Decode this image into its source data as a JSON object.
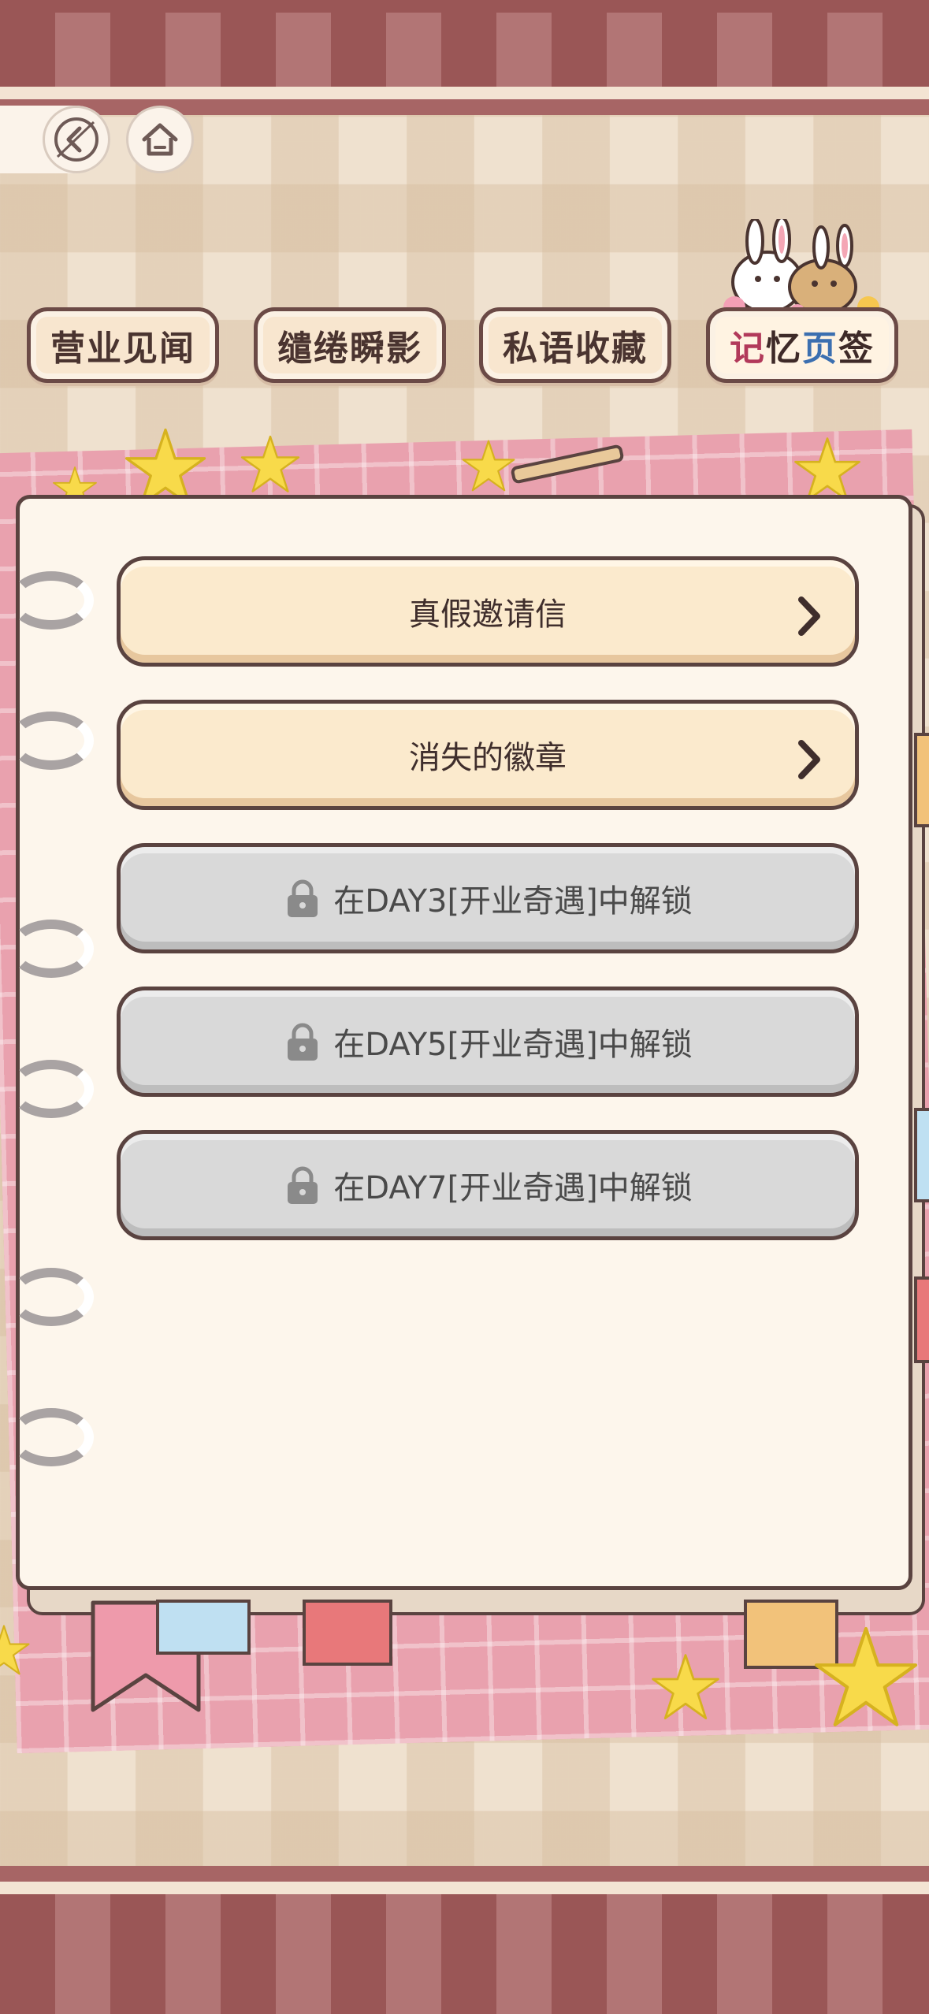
{
  "tabs": [
    {
      "label": "营业见闻",
      "active": false
    },
    {
      "label": "缱绻瞬影",
      "active": false
    },
    {
      "label": "私语收藏",
      "active": false
    },
    {
      "label": "记忆页签",
      "active": true
    }
  ],
  "active_tab_chars": [
    "记",
    "忆",
    "页",
    "签"
  ],
  "items": [
    {
      "label": "真假邀请信",
      "locked": false
    },
    {
      "label": "消失的徽章",
      "locked": false
    },
    {
      "label": "在DAY3[开业奇遇]中解锁",
      "locked": true
    },
    {
      "label": "在DAY5[开业奇遇]中解锁",
      "locked": true
    },
    {
      "label": "在DAY7[开业奇遇]中解锁",
      "locked": true
    }
  ],
  "icons": {
    "back": "back-arrow-icon",
    "home": "home-icon",
    "chevron": "chevron-right-icon",
    "lock": "lock-icon"
  },
  "colors": {
    "band": "#a35f5f",
    "tab_bg": "#f8e6cf",
    "open_item": "#fbeacd",
    "locked_item": "#d9d9d9",
    "outline": "#5a4340"
  }
}
